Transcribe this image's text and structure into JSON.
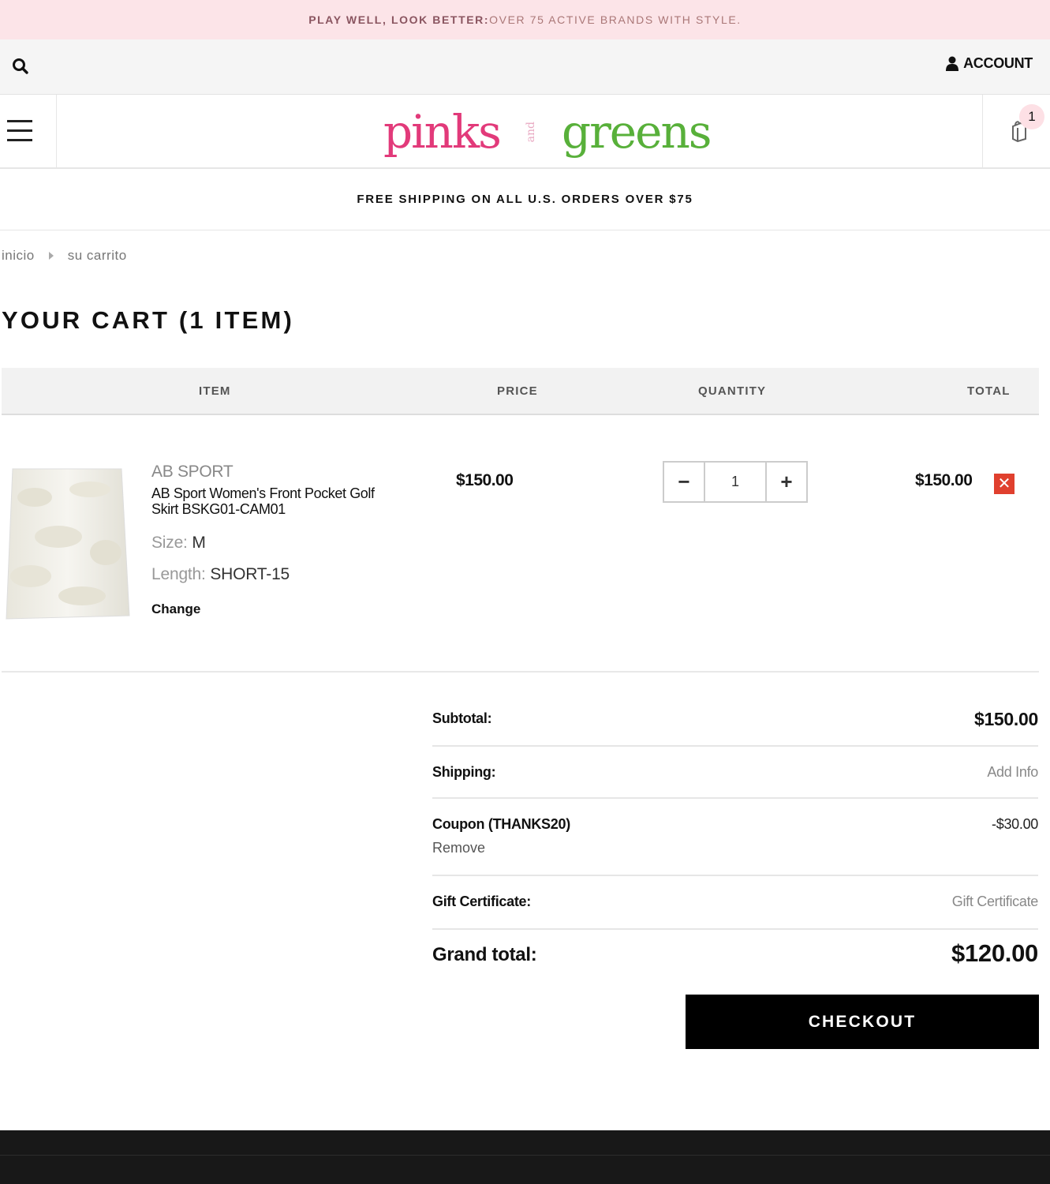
{
  "promo": {
    "bold": "PLAY WELL, LOOK BETTER:",
    "rest": " OVER 75 ACTIVE BRANDS WITH STYLE."
  },
  "utility": {
    "account_label": "ACCOUNT"
  },
  "header": {
    "logo": {
      "pinks": "pinks",
      "and": "and",
      "greens": "greens"
    },
    "cart_count": "1"
  },
  "shipping_banner": "FREE SHIPPING ON ALL U.S. ORDERS OVER $75",
  "breadcrumb": {
    "home": "inicio",
    "current": "su carrito"
  },
  "page_title": "YOUR CART (1 ITEM)",
  "table": {
    "headers": {
      "item": "ITEM",
      "price": "PRICE",
      "quantity": "QUANTITY",
      "total": "TOTAL"
    },
    "rows": [
      {
        "brand": "AB SPORT",
        "name": "AB Sport Women's Front Pocket Golf Skirt BSKG01-CAM01",
        "size_label": "Size:",
        "size_value": "M",
        "length_label": "Length:",
        "length_value": "SHORT-15",
        "change_label": "Change",
        "price": "$150.00",
        "quantity": "1",
        "total": "$150.00"
      }
    ]
  },
  "summary": {
    "subtotal_label": "Subtotal:",
    "subtotal_value": "$150.00",
    "shipping_label": "Shipping:",
    "shipping_value": "Add Info",
    "coupon_label": "Coupon (THANKS20)",
    "coupon_remove": "Remove",
    "coupon_value": "-$30.00",
    "gift_label": "Gift Certificate:",
    "gift_value": "Gift Certificate",
    "grand_label": "Grand total:",
    "grand_value": "$120.00"
  },
  "checkout_label": "CHECKOUT",
  "colors": {
    "promo_bg": "#fce4e8",
    "logo_pink": "#e23a7a",
    "logo_green": "#58b03a",
    "remove_red": "#e0402e"
  },
  "icons": [
    "search-icon",
    "user-icon",
    "hamburger-icon",
    "shopping-bag-icon",
    "chevron-right-icon",
    "minus-icon",
    "plus-icon",
    "close-icon"
  ]
}
